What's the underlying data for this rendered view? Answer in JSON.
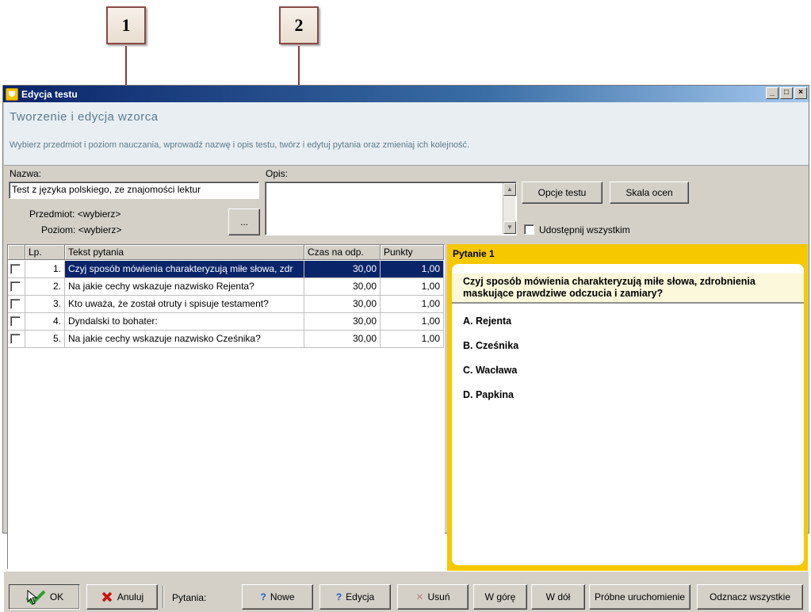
{
  "callouts": [
    "1",
    "2"
  ],
  "window": {
    "title": "Edycja testu",
    "controls": [
      "_",
      "□",
      "×"
    ]
  },
  "header": {
    "title": "Tworzenie i edycja wzorca",
    "description": "Wybierz przedmiot i poziom nauczania, wprowadź nazwę i opis testu, twórz i edytuj pytania oraz zmieniaj ich kolejność."
  },
  "form": {
    "name_label": "Nazwa:",
    "name_value": "Test z języka polskiego, ze znajomości lektur",
    "opis_label": "Opis:",
    "opis_value": "",
    "subject_label": "Przedmiot:",
    "subject_value": "<wybierz>",
    "level_label": "Poziom:",
    "level_value": "<wybierz>",
    "browse_label": "...",
    "options_button": "Opcje testu",
    "scale_button": "Skala ocen",
    "share_label": "Udostępnij wszystkim"
  },
  "grid": {
    "columns": [
      "Lp.",
      "Tekst pytania",
      "Czas na odp.",
      "Punkty"
    ],
    "rows": [
      {
        "lp": "1.",
        "text": "Czyj sposób mówienia charakteryzują miłe słowa, zdr",
        "time": "30,00",
        "points": "1,00"
      },
      {
        "lp": "2.",
        "text": "Na jakie cechy wskazuje nazwisko Rejenta?",
        "time": "30,00",
        "points": "1,00"
      },
      {
        "lp": "3.",
        "text": "Kto uważa, że został otruty i spisuje testament?",
        "time": "30,00",
        "points": "1,00"
      },
      {
        "lp": "4.",
        "text": "Dyndalski to bohater:",
        "time": "30,00",
        "points": "1,00"
      },
      {
        "lp": "5.",
        "text": "Na jakie cechy wskazuje nazwisko Cześnika?",
        "time": "30,00",
        "points": "1,00"
      }
    ]
  },
  "preview": {
    "title": "Pytanie 1",
    "question": "Czyj sposób mówienia charakteryzują miłe słowa, zdrobnienia maskujące prawdziwe odczucia i zamiary?",
    "answers": [
      "A. Rejenta",
      "B. Cześnika",
      "C. Wacława",
      "D. Papkina"
    ]
  },
  "footer": {
    "ok": "OK",
    "cancel": "Anuluj",
    "questions_label": "Pytania:",
    "new": "Nowe",
    "edit": "Edycja",
    "delete": "Usuń",
    "up": "W górę",
    "down": "W dół",
    "test_run": "Próbne uruchomienie",
    "uncheck_all": "Odznacz wszystkie"
  },
  "colors": {
    "titlebar": "#0a246a",
    "selection": "#0a246a",
    "preview_bg": "#f6c800",
    "header_text": "#5d7a8c",
    "callout_border": "#8a4a44"
  }
}
